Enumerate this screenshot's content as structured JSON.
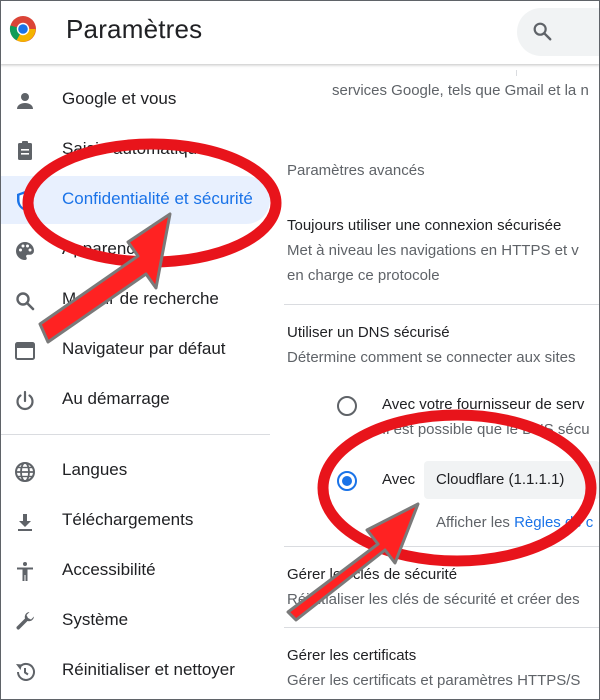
{
  "header": {
    "title": "Paramètres",
    "logo_icon": "chrome-logo",
    "search_icon": "search-icon"
  },
  "sidebar": {
    "items": [
      {
        "label": "Google et vous",
        "icon": "person-icon"
      },
      {
        "label": "Saisie automatique",
        "icon": "clipboard-icon"
      },
      {
        "label": "Confidentialité et sécurité",
        "icon": "shield-icon",
        "active": true
      },
      {
        "label": "Apparence",
        "icon": "palette-icon"
      },
      {
        "label": "Moteur de recherche",
        "icon": "search-icon"
      },
      {
        "label": "Navigateur par défaut",
        "icon": "browser-icon"
      },
      {
        "label": "Au démarrage",
        "icon": "power-icon"
      },
      {
        "label": "Langues",
        "icon": "globe-icon"
      },
      {
        "label": "Téléchargements",
        "icon": "download-icon"
      },
      {
        "label": "Accessibilité",
        "icon": "accessibility-icon"
      },
      {
        "label": "Système",
        "icon": "wrench-icon"
      },
      {
        "label": "Réinitialiser et nettoyer",
        "icon": "restore-icon"
      }
    ]
  },
  "main": {
    "top_text": "services Google, tels que Gmail et la n",
    "advanced_heading": "Paramètres avancés",
    "https": {
      "title": "Toujours utiliser une connexion sécurisée",
      "desc_line1": "Met à niveau les navigations en HTTPS et v",
      "desc_line2": "en charge ce protocole"
    },
    "dns": {
      "title": "Utiliser un DNS sécurisé",
      "desc": "Détermine comment se connecter aux sites",
      "option_provider": "Avec votre fournisseur de serv",
      "option_provider_sub": "Il est possible que le DNS sécu",
      "option_custom_prefix": "Avec",
      "selected_provider": "Cloudflare (1.1.1.1)",
      "footer_prefix": "Afficher les ",
      "footer_link": "Règles de c"
    },
    "security_keys": {
      "title": "Gérer les clés de sécurité",
      "desc": "Réinitialiser les clés de sécurité et créer des"
    },
    "certificates": {
      "title": "Gérer les certificats",
      "desc": "Gérer les certificats et paramètres HTTPS/S"
    }
  },
  "colors": {
    "accent": "#1a73e8",
    "active_bg": "#e8f0fe",
    "annotation_red": "#e8141b"
  }
}
